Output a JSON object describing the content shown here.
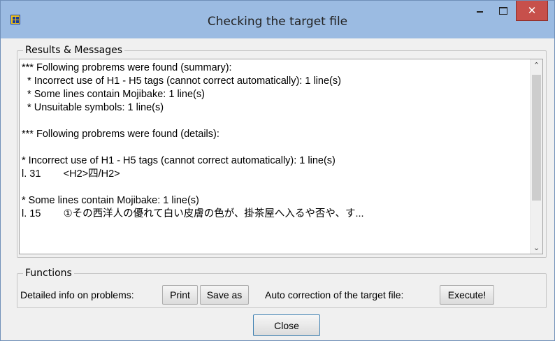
{
  "window": {
    "title": "Checking the target file",
    "close_glyph": "✕",
    "icon": "app-grid-icon"
  },
  "results": {
    "group_label": "Results & Messages",
    "lines": [
      "*** Following probrems were found (summary):",
      "  * Incorrect use of H1 - H5 tags (cannot correct automatically): 1 line(s)",
      "  * Some lines contain Mojibake: 1 line(s)",
      "  * Unsuitable symbols: 1 line(s)",
      "",
      "*** Following probrems were found (details):",
      "",
      "* Incorrect use of H1 - H5 tags (cannot correct automatically): 1 line(s)",
      "l. 31        <H2>四/H2>",
      "",
      "* Some lines contain Mojibake: 1 line(s)",
      "l. 15        ①その西洋人の優れて白い皮膚の色が、掛茶屋へ入るや否や、す..."
    ],
    "scroll_up_glyph": "⌃",
    "scroll_down_glyph": "⌄"
  },
  "functions": {
    "group_label": "Functions",
    "detailed_info_label": "Detailed info on problems:",
    "print_label": "Print",
    "save_as_label": "Save as",
    "auto_correction_label": "Auto correction of the target file:",
    "execute_label": "Execute!"
  },
  "footer": {
    "close_label": "Close"
  },
  "colors": {
    "titlebar": "#9bbbe2",
    "close_button": "#c7504b",
    "window_bg": "#f0f0f0"
  }
}
